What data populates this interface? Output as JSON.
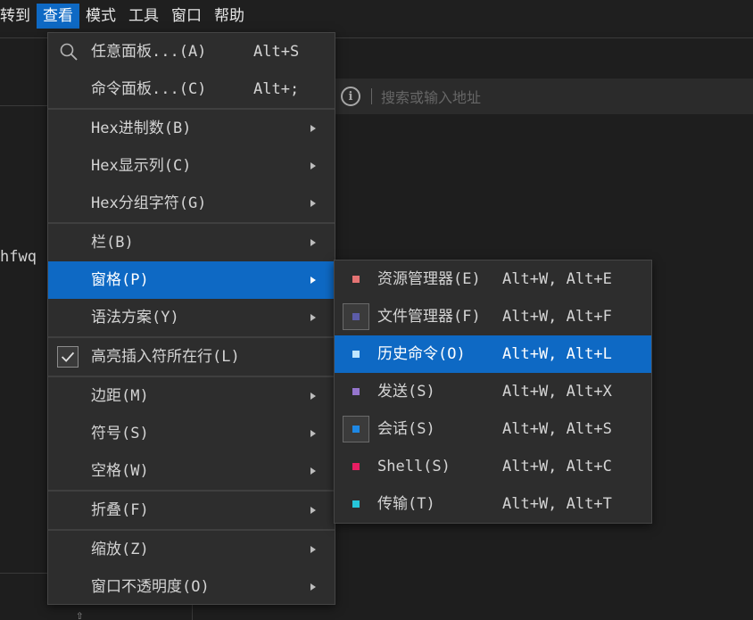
{
  "menubar": {
    "items": [
      "转到",
      "查看",
      "模式",
      "工具",
      "窗口",
      "帮助"
    ]
  },
  "address_bar": {
    "placeholder": "搜索或输入地址"
  },
  "background": {
    "text": "hfwq"
  },
  "view_menu": {
    "items": [
      {
        "label": "任意面板...(A)",
        "shortcut": "Alt+S",
        "icon": "search-icon"
      },
      {
        "label": "命令面板...(C)",
        "shortcut": "Alt+;"
      },
      {
        "label": "Hex进制数(B)",
        "submenu": true
      },
      {
        "label": "Hex显示列(C)",
        "submenu": true
      },
      {
        "label": "Hex分组字符(G)",
        "submenu": true
      },
      {
        "label": "栏(B)",
        "submenu": true
      },
      {
        "label": "窗格(P)",
        "submenu": true,
        "highlighted": true
      },
      {
        "label": "语法方案(Y)",
        "submenu": true
      },
      {
        "label": "高亮插入符所在行(L)",
        "checked": true
      },
      {
        "label": "边距(M)",
        "submenu": true
      },
      {
        "label": "符号(S)",
        "submenu": true
      },
      {
        "label": "空格(W)",
        "submenu": true
      },
      {
        "label": "折叠(F)",
        "submenu": true
      },
      {
        "label": "缩放(Z)",
        "submenu": true
      },
      {
        "label": "窗口不透明度(O)",
        "submenu": true
      }
    ]
  },
  "panes_submenu": {
    "items": [
      {
        "label": "资源管理器(E)",
        "shortcut": "Alt+W, Alt+E",
        "color": "#e57373"
      },
      {
        "label": "文件管理器(F)",
        "shortcut": "Alt+W, Alt+F",
        "color": "#5c5ca8",
        "boxed": true
      },
      {
        "label": "历史命令(O)",
        "shortcut": "Alt+W, Alt+L",
        "color": "#bfe6ff",
        "highlighted": true
      },
      {
        "label": "发送(S)",
        "shortcut": "Alt+W, Alt+X",
        "color": "#9575cd"
      },
      {
        "label": "会话(S)",
        "shortcut": "Alt+W, Alt+S",
        "color": "#1e88e5",
        "boxed": true
      },
      {
        "label": "Shell(S)",
        "shortcut": "Alt+W, Alt+C",
        "color": "#e91e63"
      },
      {
        "label": "传输(T)",
        "shortcut": "Alt+W, Alt+T",
        "color": "#26c6da"
      }
    ]
  },
  "colors": {
    "accent": "#0e69c4",
    "menu_bg": "#2d2d2d",
    "app_bg": "#1e1e1e"
  }
}
